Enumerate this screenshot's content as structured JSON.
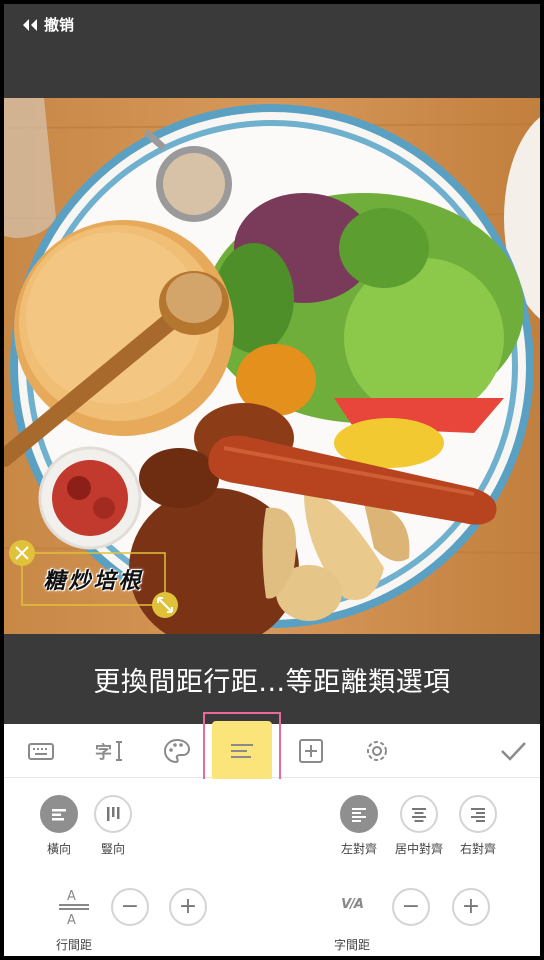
{
  "header": {
    "undo_label": "撤销"
  },
  "photo": {
    "sticker_text": "糖炒培根"
  },
  "hint": {
    "text": "更換間距行距...等距離類選項"
  },
  "toolbar": {
    "items": [
      "keyboard-icon",
      "font-icon",
      "palette-icon",
      "align-icon",
      "add-icon",
      "settings-icon",
      "confirm-check-icon"
    ],
    "selected": "align-icon",
    "highlight_color": "#fbe47a",
    "outline_color": "#e86a9a"
  },
  "direction": {
    "horizontal_label": "橫向",
    "vertical_label": "豎向",
    "selected": "horizontal"
  },
  "alignment": {
    "left_label": "左對齊",
    "center_label": "居中對齊",
    "right_label": "右對齊",
    "selected": "left"
  },
  "line_spacing": {
    "label": "行間距",
    "decrease": "−",
    "increase": "+"
  },
  "char_spacing": {
    "label": "字間距",
    "icon_text": "V/A",
    "decrease": "−",
    "increase": "+"
  },
  "colors": {
    "bar_dark": "#3a3a3a",
    "selected_circle": "#8f8f8f",
    "sticker_yellow": "#e0c23a"
  }
}
